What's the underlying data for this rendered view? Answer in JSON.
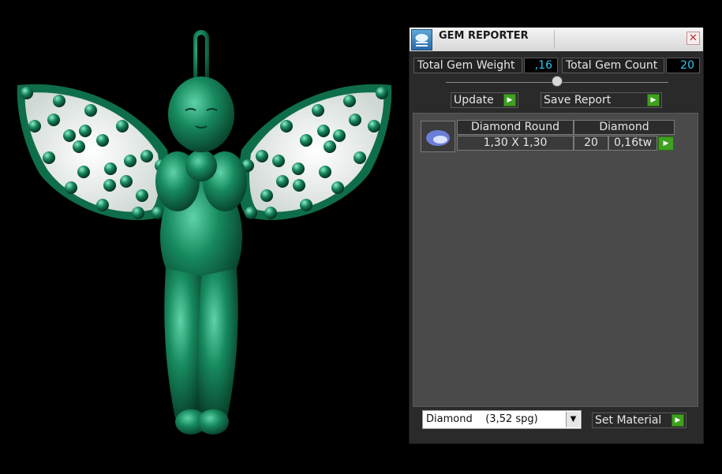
{
  "window": {
    "title": "GEM REPORTER",
    "close_glyph": "✕"
  },
  "totals": {
    "weight_label": "Total Gem Weight",
    "weight_value": ",16",
    "count_label": "Total Gem Count",
    "count_value": "20"
  },
  "actions": {
    "update_label": "Update",
    "save_report_label": "Save Report",
    "go_glyph": "▶"
  },
  "gems": [
    {
      "shape": "Diamond Round",
      "size": "1,30 X 1,30",
      "material": "Diamond",
      "count": "20",
      "weight": "0,16tw"
    }
  ],
  "material": {
    "selected": "Diamond    (3,52 spg)",
    "set_label": "Set Material",
    "dropdown_glyph": "▼"
  },
  "colors": {
    "accent_green": "#3ea11f",
    "value_cyan": "#2fc6f0",
    "model_green": "#1e8e63"
  },
  "icons": [
    "gem-reporter-icon",
    "close-icon",
    "arrow-right-icon",
    "chevron-down-icon",
    "gem-thumbnail-icon"
  ]
}
